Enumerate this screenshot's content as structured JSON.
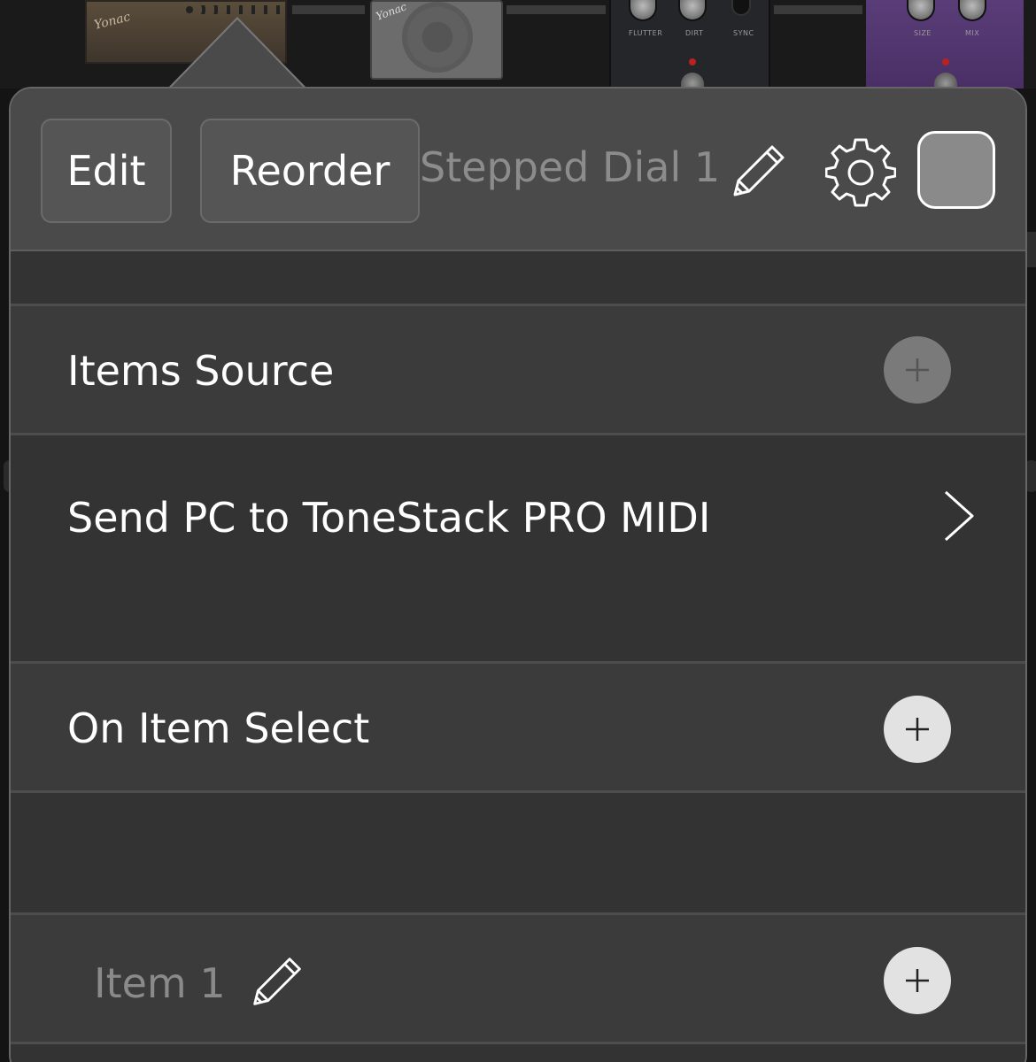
{
  "background": {
    "amp_logo": "Yonac",
    "cab_logo": "Yonac",
    "pedal_labels": [
      "FLUTTER",
      "DIRT",
      "SYNC"
    ],
    "purple_pedal_labels": [
      "SIZE",
      "MIX"
    ]
  },
  "header": {
    "edit_label": "Edit",
    "reorder_label": "Reorder",
    "title": "Stepped Dial 1",
    "swatch_color": "#8a8a8a"
  },
  "rows": {
    "items_source": {
      "label": "Items Source",
      "button_state": "disabled"
    },
    "send_pc": {
      "label": "Send PC to ToneStack PRO MIDI"
    },
    "on_item_select": {
      "label": "On Item Select",
      "button_state": "enabled"
    },
    "item": {
      "label": "Item 1",
      "button_state": "enabled"
    }
  },
  "icons": {
    "header_edit": "pencil-icon",
    "settings": "gear-icon",
    "add": "plus-icon",
    "disclosure": "chevron-right-icon",
    "item_edit": "pencil-icon"
  }
}
